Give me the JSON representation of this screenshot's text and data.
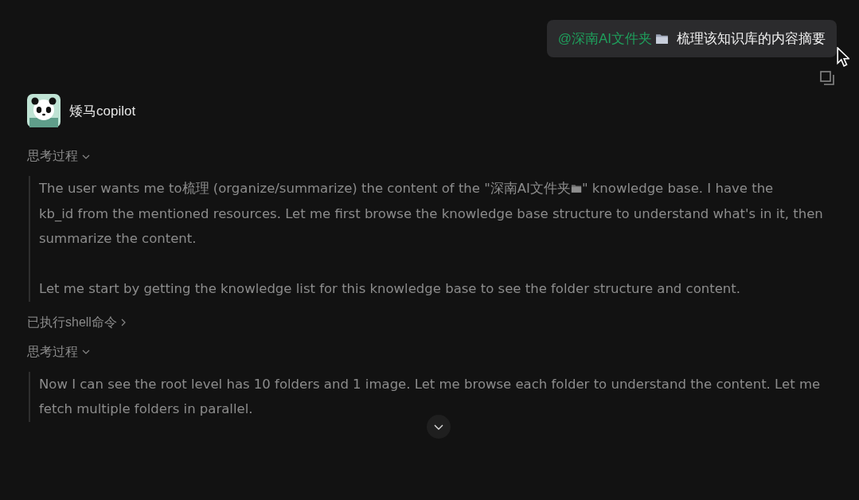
{
  "user_message": {
    "mention": "@深南AI文件夹",
    "text": "梳理该知识库的内容摘要"
  },
  "assistant": {
    "name": "矮马copilot"
  },
  "steps": [
    {
      "kind": "thinking",
      "label": "思考过程",
      "expanded": true,
      "paragraphs": [
        [
          {
            "kind": "text",
            "text": "The user wants me to梳理 (organize/summarize) the content of the \"深南AI文件夹"
          },
          {
            "kind": "folder"
          },
          {
            "kind": "text",
            "text": "\" knowledge base. I have the"
          },
          {
            "kind": "text",
            "text": "kb_id from the mentioned resources. Let me first browse the knowledge base structure to understand what's in it, then summarize the content."
          }
        ],
        [
          {
            "kind": "text",
            "text": "Let me start by getting the knowledge list for this knowledge base to see the folder structure and content."
          }
        ]
      ]
    },
    {
      "kind": "tool",
      "label": "已执行shell命令",
      "expanded": false
    },
    {
      "kind": "thinking",
      "label": "思考过程",
      "expanded": true,
      "paragraphs": [
        [
          {
            "kind": "text",
            "text": "Now I can see the root level has 10 folders and 1 image. Let me browse each folder to understand the content. Let me fetch multiple folders in parallel."
          }
        ]
      ]
    }
  ]
}
